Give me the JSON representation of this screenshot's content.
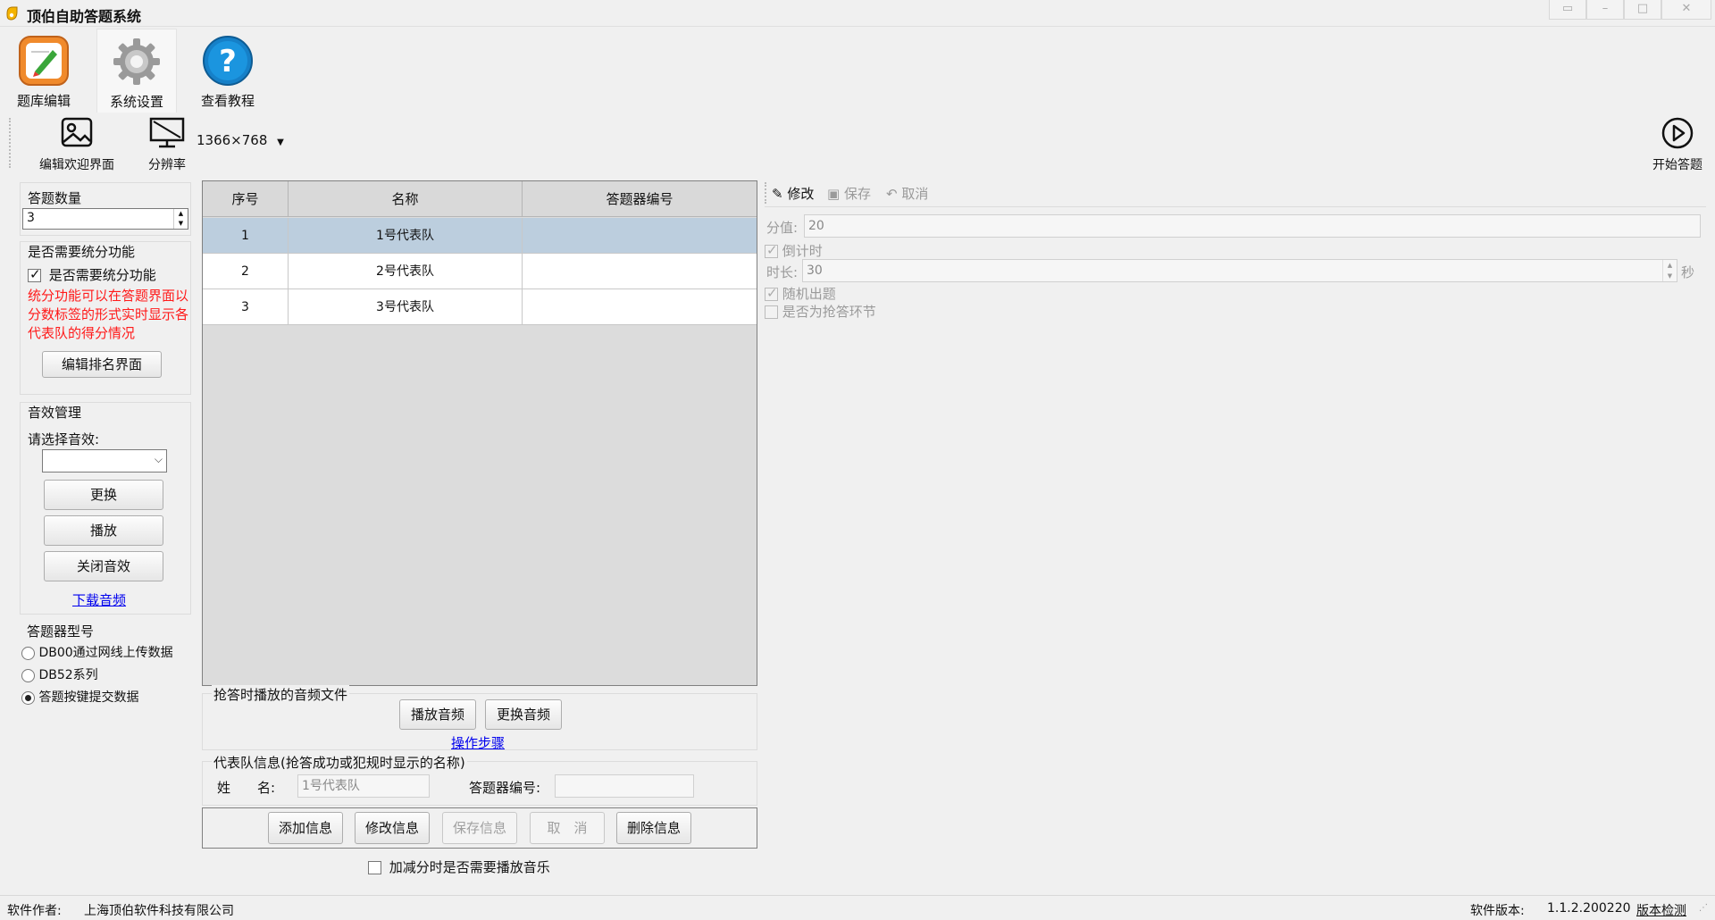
{
  "window": {
    "title": "顶伯自助答题系统"
  },
  "ribbon": {
    "items": [
      {
        "label": "题库编辑"
      },
      {
        "label": "系统设置"
      },
      {
        "label": "查看教程"
      }
    ]
  },
  "toolbar": {
    "edit_welcome": "编辑欢迎界面",
    "resolution_label": "分辨率",
    "resolution_value": "1366×768",
    "start": "开始答题"
  },
  "left": {
    "count_title": "答题数量",
    "count_value": "3",
    "score_group_title": "是否需要统分功能",
    "score_checkbox": "是否需要统分功能",
    "score_note": "统分功能可以在答题界面以分数标签的形式实时显示各代表队的得分情况",
    "edit_ranking": "编辑排名界面",
    "sound_title": "音效管理",
    "sound_select_label": "请选择音效:",
    "sound_select_value": "",
    "btn_change": "更换",
    "btn_play": "播放",
    "btn_close_sound": "关闭音效",
    "download_audio": "下载音频",
    "device_title": "答题器型号",
    "device_options": [
      "DB00通过网线上传数据",
      "DB52系列",
      "答题按键提交数据"
    ]
  },
  "table": {
    "headers": [
      "序号",
      "名称",
      "答题器编号"
    ],
    "rows": [
      {
        "no": "1",
        "name": "1号代表队",
        "device": ""
      },
      {
        "no": "2",
        "name": "2号代表队",
        "device": ""
      },
      {
        "no": "3",
        "name": "3号代表队",
        "device": ""
      }
    ]
  },
  "audio_section": {
    "title": "抢答时播放的音频文件",
    "play": "播放音频",
    "change": "更换音频",
    "steps_link": "操作步骤"
  },
  "team_info": {
    "title": "代表队信息(抢答成功或犯规时显示的名称)",
    "name_label": "姓　　名:",
    "name_value": "1号代表队",
    "device_label": "答题器编号:",
    "device_value": ""
  },
  "actions": {
    "add": "添加信息",
    "modify": "修改信息",
    "save": "保存信息",
    "cancel": "取　消",
    "delete": "删除信息"
  },
  "music_checkbox": "加减分时是否需要播放音乐",
  "right": {
    "edit": "修改",
    "save": "保存",
    "cancel": "取消",
    "score_label": "分值:",
    "score_value": "20",
    "countdown": "倒计时",
    "duration_label": "时长:",
    "duration_value": "30",
    "duration_unit": "秒",
    "random": "随机出题",
    "buzzer": "是否为抢答环节"
  },
  "status": {
    "author_label": "软件作者:",
    "author_value": "上海顶伯软件科技有限公司",
    "version_label": "软件版本:",
    "version_value": "1.1.2.200220",
    "check_version": "版本检测"
  }
}
